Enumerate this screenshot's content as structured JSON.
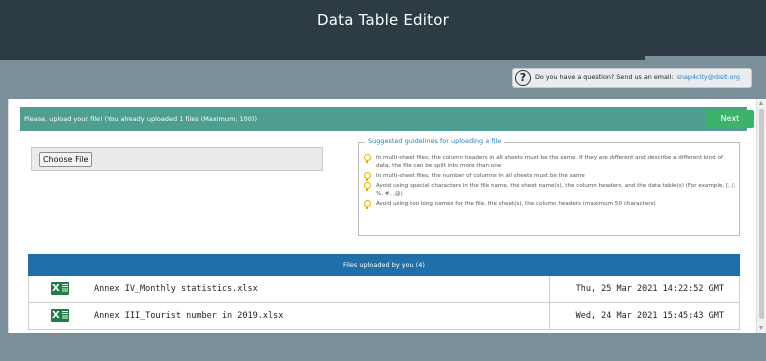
{
  "app": {
    "title": "Data Table Editor"
  },
  "help": {
    "text": "Do you have a question? Send us an email:",
    "email": "snap4city@disit.org",
    "icon": "question-circle-icon"
  },
  "upload": {
    "message": "Please, upload your file! (You already uploaded 1 files (Maximum: 100))",
    "next_label": "Next",
    "choose_file_label": "Choose File"
  },
  "guidelines": {
    "title": "Suggested guidelines for uploading a file",
    "icon": "lightbulb-icon",
    "items": [
      "In multi-sheet files, the column headers in all sheets must be the same. If they are different and describe a different kind of data, the file can be split into more than one",
      "In multi-sheet files, the number of columns in all sheets must be the same",
      "Avoid using special characters in the file name, the sheet name(s), the column headers, and the data table(s) (For example, [, /, %, #, ,@)",
      "Avoid using too long names for the file, the sheet(s), the column headers (maximum 50 characters)"
    ]
  },
  "files": {
    "header": "Files uploaded by you (4)",
    "rows": [
      {
        "name": "Annex IV_Monthly statistics.xlsx",
        "date": "Thu, 25 Mar 2021 14:22:52 GMT"
      },
      {
        "name": "Annex III_Tourist number in 2019.xlsx",
        "date": "Wed, 24 Mar 2021 15:45:43 GMT"
      }
    ]
  },
  "colors": {
    "header_bg": "#2c3b44",
    "page_bg": "#7a8f99",
    "upload_bar": "#4e9f90",
    "next_button": "#3bb36a",
    "files_header": "#1f6fa8",
    "excel_green": "#1e7f45",
    "link_blue": "#2a7fb8"
  }
}
